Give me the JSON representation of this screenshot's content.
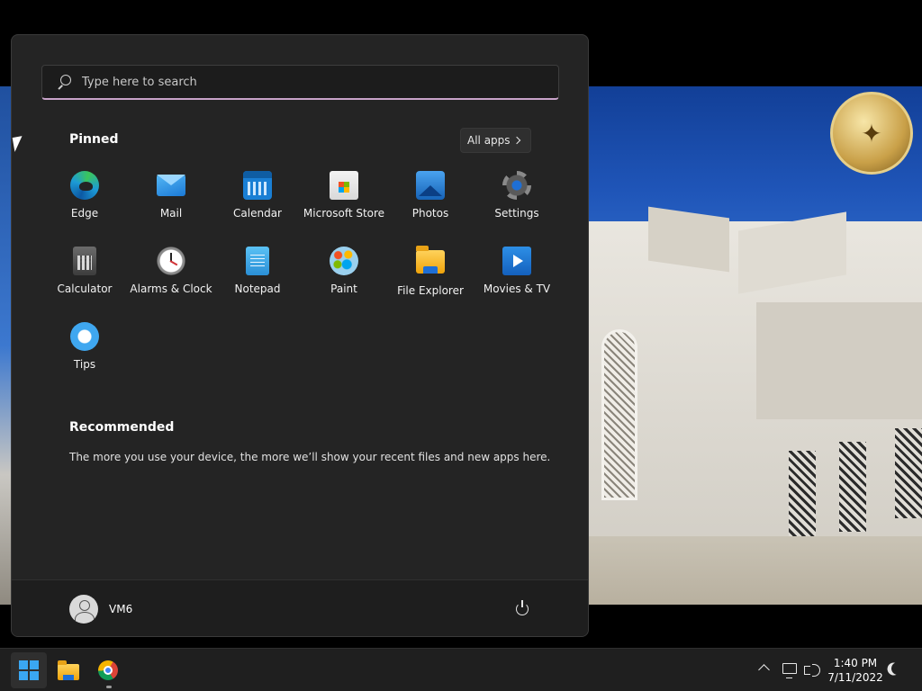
{
  "search": {
    "placeholder": "Type here to search"
  },
  "pinned": {
    "title": "Pinned",
    "all_apps_label": "All apps",
    "apps": [
      {
        "label": "Edge",
        "icon": "edge-icon"
      },
      {
        "label": "Mail",
        "icon": "mail-icon"
      },
      {
        "label": "Calendar",
        "icon": "calendar-icon"
      },
      {
        "label": "Microsoft Store",
        "icon": "store-icon"
      },
      {
        "label": "Photos",
        "icon": "photos-icon"
      },
      {
        "label": "Settings",
        "icon": "settings-icon"
      },
      {
        "label": "Calculator",
        "icon": "calculator-icon"
      },
      {
        "label": "Alarms & Clock",
        "icon": "clock-icon"
      },
      {
        "label": "Notepad",
        "icon": "notepad-icon"
      },
      {
        "label": "Paint",
        "icon": "paint-icon"
      },
      {
        "label": "File Explorer",
        "icon": "folder-icon"
      },
      {
        "label": "Movies & TV",
        "icon": "movies-icon"
      },
      {
        "label": "Tips",
        "icon": "lightbulb-icon"
      }
    ]
  },
  "recommended": {
    "title": "Recommended",
    "text": "The more you use your device, the more we’ll show your recent files and new apps here."
  },
  "user": {
    "name": "VM6"
  },
  "taskbar": {
    "items": [
      "start-icon",
      "file-explorer-icon",
      "chrome-icon"
    ],
    "time": "1:40 PM",
    "date": "7/11/2022"
  },
  "colors": {
    "accent": "#3aa7f2",
    "menu_bg": "#242424",
    "taskbar_bg": "#1f1f1f"
  }
}
